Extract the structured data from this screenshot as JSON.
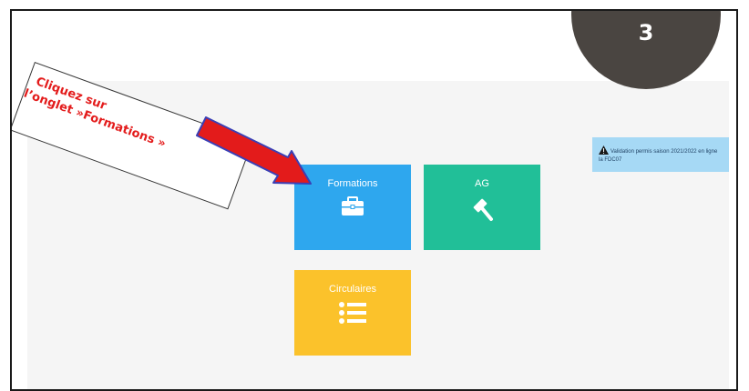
{
  "slide": {
    "step_number": "3"
  },
  "callout": {
    "line1": "Cliquez sur",
    "line2": "l’onglet »Formations »"
  },
  "tiles": [
    {
      "label": "Formations",
      "icon": "briefcase-icon",
      "color": "#2ea7ee"
    },
    {
      "label": "AG",
      "icon": "gavel-icon",
      "color": "#21bf98"
    },
    {
      "label": "Circulaires",
      "icon": "list-icon",
      "color": "#fbc22b"
    }
  ],
  "notice": {
    "icon": "warning-icon",
    "line1": "Validation permis saison 2021/2022 en ligne",
    "line2": "la FDC07"
  },
  "colors": {
    "arrow": "#e31b1b",
    "arrow_outline": "#3a3fb5",
    "badge": "#4a4541",
    "callout_text": "#e31b1b"
  }
}
